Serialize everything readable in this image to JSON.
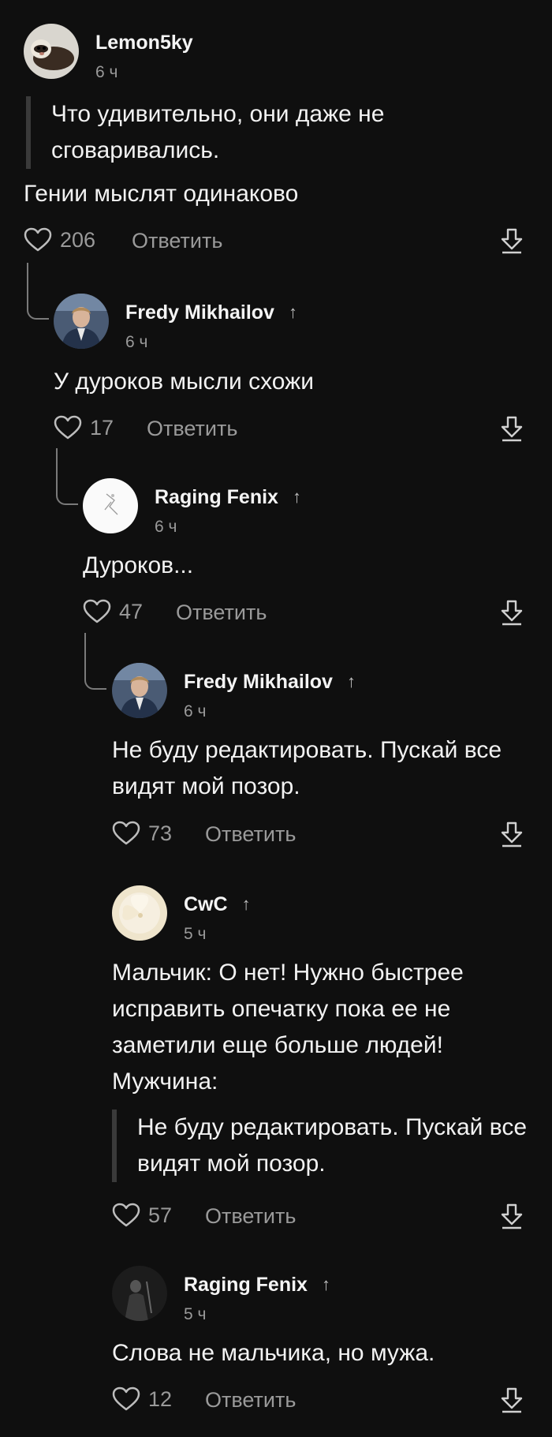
{
  "comments": [
    {
      "author": "Lemon5ky",
      "time": "6 ч",
      "quote": "Что удивительно, они даже не сговаривались.",
      "text": "Гении мыслят одинаково",
      "likes": "206",
      "reply": "Ответить",
      "avatar": "ferret-avatar"
    },
    {
      "author": "Fredy Mikhailov",
      "time": "6 ч",
      "text": "У дуроков мысли схожи",
      "likes": "17",
      "reply": "Ответить",
      "avatar": "man-avatar"
    },
    {
      "author": "Raging Fenix",
      "time": "6 ч",
      "text": "Дуроков...",
      "likes": "47",
      "reply": "Ответить",
      "avatar": "white-sketch-avatar"
    },
    {
      "author": "Fredy Mikhailov",
      "time": "6 ч",
      "text": "Не буду редактировать. Пускай все видят мой позор.",
      "likes": "73",
      "reply": "Ответить",
      "avatar": "man-avatar"
    },
    {
      "author": "CwC",
      "time": "5 ч",
      "text_lines": [
        "Мальчик: О нет! Нужно быстрее",
        "исправить опечатку пока ее не",
        "заметили еще больше людей!",
        "Мужчина:"
      ],
      "quote": "Не буду редактировать. Пускай все видят мой позор.",
      "likes": "57",
      "reply": "Ответить",
      "avatar": "flower-avatar"
    },
    {
      "author": "Raging Fenix",
      "time": "5 ч",
      "text": "Слова не мальчика, но мужа.",
      "likes": "12",
      "reply": "Ответить",
      "avatar": "dark-figure-avatar"
    }
  ],
  "colors": {
    "background": "#0f0f0f",
    "text": "#f2f2f2",
    "secondary": "#9a9a9a",
    "quote_bar": "#3a3a3a"
  },
  "icons": {
    "like": "heart-outline-icon",
    "collapse": "arrow-down-to-line-icon",
    "author_reply": "arrow-up-icon"
  }
}
